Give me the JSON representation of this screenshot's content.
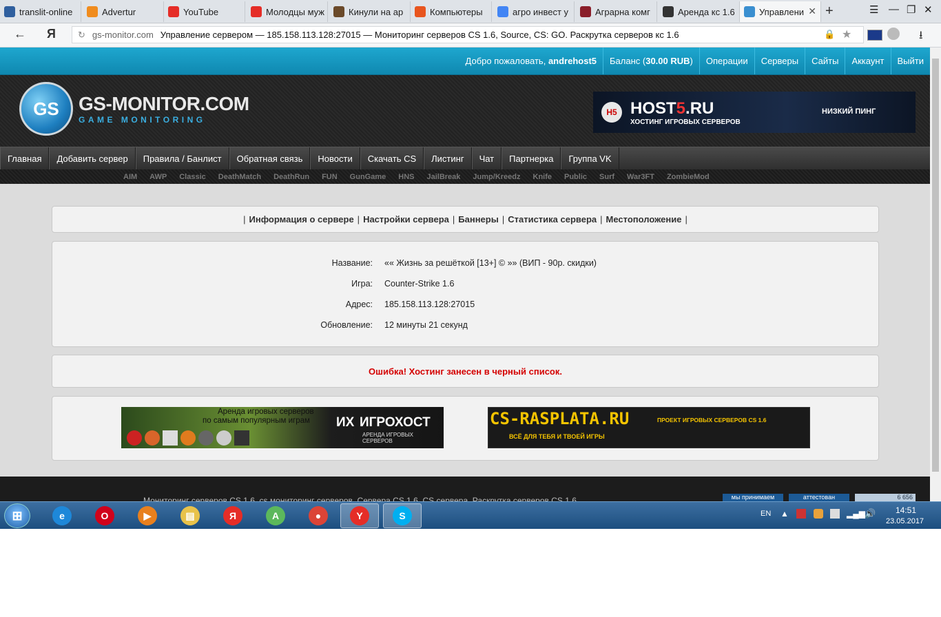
{
  "browser": {
    "tabs": [
      {
        "label": "translit-online",
        "icon": "translit-icon",
        "color": "#2f5f9e"
      },
      {
        "label": "Advertur",
        "icon": "advertur-icon",
        "color": "#f08c1e"
      },
      {
        "label": "YouTube",
        "icon": "youtube-icon",
        "color": "#e52d27"
      },
      {
        "label": "Молодцы муж",
        "icon": "youtube-icon",
        "color": "#e52d27"
      },
      {
        "label": "Кинули на ар",
        "icon": "person-icon",
        "color": "#6b4a2a"
      },
      {
        "label": "Компьютеры",
        "icon": "aliexpress-icon",
        "color": "#e8551e"
      },
      {
        "label": "агро инвест у",
        "icon": "google-icon",
        "color": "#4285f4"
      },
      {
        "label": "Аграрна комг",
        "icon": "shield-icon",
        "color": "#8a1e2a"
      },
      {
        "label": "Аренда кс 1.6",
        "icon": "clapper-icon",
        "color": "#333333"
      },
      {
        "label": "Управлени",
        "icon": "gsmonitor-icon",
        "color": "#3a8fd0"
      }
    ],
    "new_tab": "+",
    "back": "←",
    "yandex_logo": "Я",
    "url_host": "gs-monitor.com",
    "url_title": "Управление сервером — 185.158.113.128:27015 — Мониторинг серверов CS 1.6, Source, CS: GO. Раскрутка серверов кс 1.6",
    "lang_flag": "EN"
  },
  "userbar": {
    "welcome": "Добро пожаловать, ",
    "username": "andrehost5",
    "balance_prefix": "Баланс (",
    "balance": "30.00 RUB",
    "balance_suffix": ")",
    "links": [
      "Операции",
      "Серверы",
      "Сайты",
      "Аккаунт",
      "Выйти"
    ]
  },
  "logo": {
    "mark": "GS",
    "title": "GS-MONITOR.COM",
    "subtitle": "GAME MONITORING"
  },
  "header_banner": {
    "badge": "H5",
    "title_a": "HOST",
    "title_b": "5",
    "title_c": ".RU",
    "sub": "ХОСТИНГ ИГРОВЫХ СЕРВЕРОВ",
    "right": "НИЗКИЙ ПИНГ"
  },
  "main_nav": [
    "Главная",
    "Добавить сервер",
    "Правила / Банлист",
    "Обратная связь",
    "Новости",
    "Скачать CS",
    "Листинг",
    "Чат",
    "Партнерка",
    "Группа VK"
  ],
  "sub_nav": [
    "AIM",
    "AWP",
    "Classic",
    "DeathMatch",
    "DeathRun",
    "FUN",
    "GunGame",
    "HNS",
    "JailBreak",
    "Jump/Kreedz",
    "Knife",
    "Public",
    "Surf",
    "War3FT",
    "ZombieMod"
  ],
  "server_links": [
    "Информация о сервере",
    "Настройки сервера",
    "Баннеры",
    "Статистика сервера",
    "Местоположение"
  ],
  "server_info": [
    {
      "key": "Название:",
      "value": "«« Жизнь за решёткой [13+] © »» (ВИП - 90р. скидки)"
    },
    {
      "key": "Игра:",
      "value": "Counter-Strike 1.6"
    },
    {
      "key": "Адрес:",
      "value": "185.158.113.128:27015"
    },
    {
      "key": "Обновление:",
      "value": "12 минуты 21 секунд"
    }
  ],
  "error_message": "Ошибка! Хостинг занесен в черный список.",
  "banner1": {
    "line1": "Аренда игровых серверов",
    "line2": "по самым популярным играм",
    "brand": "ИГРОХОСТ",
    "brand_mark": "ИХ",
    "brand_sub": "АРЕНДА ИГРОВЫХ СЕРВЕРОВ"
  },
  "banner2": {
    "title": "CS-RASPLATA.RU",
    "right": "ПРОЕКТ ИГРОВЫХ СЕРВЕРОВ CS 1.6",
    "tagline": "ВСЁ ДЛЯ ТЕБЯ И ТВОЕЙ ИГРЫ"
  },
  "footer": {
    "text": "Мониторинг серверов CS 1.6, cs мониторинг серверов, Сервера CS 1.6, CS сервера, Раскрутка серверов CS 1.6",
    "badge1": "мы принимаем",
    "badge2": "аттестован",
    "badge3": "6 656"
  },
  "taskbar": {
    "apps": [
      {
        "name": "ie-icon",
        "glyph": "e",
        "color": "#1e88d9"
      },
      {
        "name": "opera-icon",
        "glyph": "O",
        "color": "#d0021b"
      },
      {
        "name": "media-player-icon",
        "glyph": "▶",
        "color": "#e8801e"
      },
      {
        "name": "file-explorer-icon",
        "glyph": "▤",
        "color": "#e8c24a"
      },
      {
        "name": "yandex-icon",
        "glyph": "Я",
        "color": "#e52d27"
      },
      {
        "name": "android-icon",
        "glyph": "A",
        "color": "#5cb85c"
      },
      {
        "name": "chrome-icon",
        "glyph": "●",
        "color": "#db4437"
      },
      {
        "name": "yandex-browser-icon",
        "glyph": "Y",
        "color": "#e52d27"
      },
      {
        "name": "skype-icon",
        "glyph": "S",
        "color": "#00aff0"
      }
    ],
    "lang": "EN",
    "time": "14:51",
    "date": "23.05.2017"
  }
}
